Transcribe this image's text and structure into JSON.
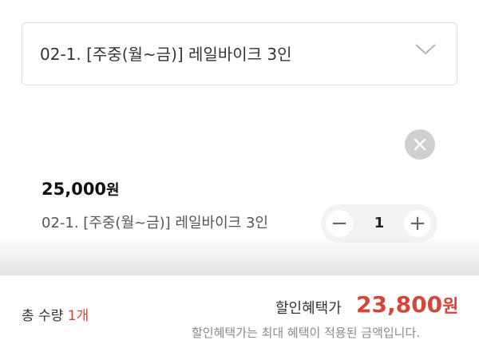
{
  "option_select": {
    "selected": "02-1. [주중(월~금)] 레일바이크 3인",
    "icon": "chevron-down-icon"
  },
  "selected_item": {
    "remove_icon": "close-icon",
    "price": "25,000",
    "price_unit": "원",
    "name": "02-1. [주중(월~금)] 레일바이크 3인",
    "quantity": "1",
    "minus_label": "−",
    "plus_label": "+"
  },
  "summary": {
    "total_qty_label": "총 수량",
    "total_qty_value": "1개",
    "discount_label": "할인혜택가",
    "discount_price": "23,800",
    "discount_unit": "원",
    "notice": "할인혜택가는 최대 혜택이 적용된 금액입니다."
  },
  "colors": {
    "accent": "#d6453a",
    "border": "#dedede",
    "remove_button": "#cfcfcf",
    "stepper_bg": "#f2f2f2"
  }
}
